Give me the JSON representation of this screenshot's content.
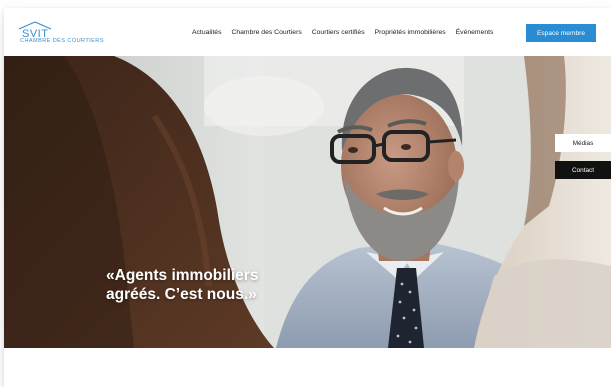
{
  "header": {
    "logo": {
      "name": "SVIT",
      "subtitle": "CHAMBRE DES COURTIERS"
    },
    "nav": [
      {
        "label": "Actualités"
      },
      {
        "label": "Chambre des Courtiers"
      },
      {
        "label": "Courtiers certifiés"
      },
      {
        "label": "Propriétés immobilières"
      },
      {
        "label": "Événements"
      }
    ],
    "cta_label": "Espace membre"
  },
  "hero": {
    "quote_line1": "«Agents immobiliers",
    "quote_line2": "agréés. C’est nous.»"
  },
  "side_tabs": {
    "medias": "Médias",
    "contact": "Contact"
  },
  "colors": {
    "brand_blue": "#2a8cd2",
    "logo_blue": "#3a8fcf",
    "contact_bg": "#111111"
  }
}
